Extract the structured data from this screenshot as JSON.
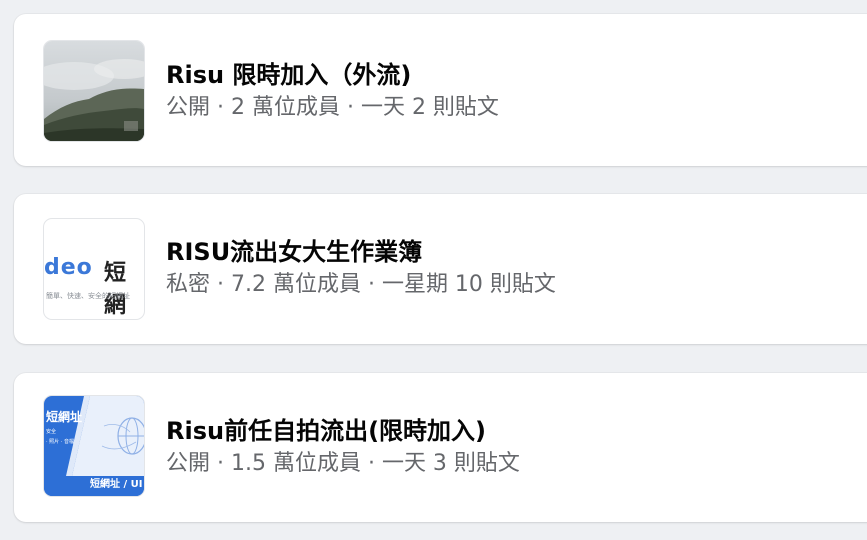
{
  "groups": [
    {
      "name": "Risu 限時加入（外流)",
      "meta": "公開 · 2 萬位成員 · 一天 2 則貼文",
      "thumbnail": "misty-mountain-photo"
    },
    {
      "name": "RISU流出女大生作業簿",
      "meta": "私密 · 7.2 萬位成員 · 一星期 10 則貼文",
      "thumbnail": "short-url-banner",
      "thumb_text": {
        "word": "deo",
        "han": "短網",
        "sub": "簡單、快速、安全的短網址"
      }
    },
    {
      "name": "Risu前任自拍流出(限時加入)",
      "meta": "公開 · 1.5 萬位成員 · 一天 3 則貼文",
      "thumbnail": "short-url-blue-banner",
      "thumb_text": {
        "title": "短網址",
        "line1": "安全",
        "line2": "· 照片 · 音檔",
        "foot": "短網址 / UI"
      }
    }
  ],
  "colors": {
    "page_bg": "#eef0f3",
    "card_bg": "#ffffff",
    "title": "#050505",
    "meta": "#65676b",
    "accent_blue": "#2d6fd6"
  }
}
